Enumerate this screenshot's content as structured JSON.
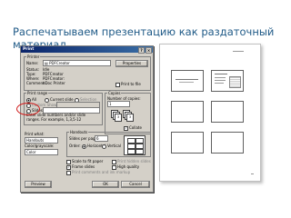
{
  "slide_title": "Распечатываем презентацию как раздаточный материал",
  "dialog": {
    "title": "Print",
    "printer": {
      "caption": "Printer",
      "name_label": "Name:",
      "name_value": "PDFCreator",
      "properties_button": "Properties",
      "status_label": "Status:",
      "status_value": "Idle",
      "type_label": "Type:",
      "type_value": "PDFCreator",
      "where_label": "Where:",
      "where_value": "PDFCreator:",
      "comment_label": "Comment:",
      "comment_value": "eDoc Printer",
      "print_to_file": "Print to file"
    },
    "print_range": {
      "caption": "Print range",
      "all": "All",
      "current_slide": "Current slide",
      "selection": "Selection",
      "custom_show": "Custom Show:",
      "slides": "Slides:",
      "hint": "Enter slide numbers and/or slide ranges. For example, 1,3,5-12"
    },
    "copies": {
      "caption": "Copies",
      "number_label": "Number of copies:",
      "number_value": "1",
      "collate": "Collate"
    },
    "print_what": {
      "label": "Print what:",
      "value": "Handouts"
    },
    "color": {
      "label": "Color/grayscale:",
      "value": "Color"
    },
    "handouts": {
      "caption": "Handouts",
      "slides_per_page_label": "Slides per page:",
      "slides_per_page_value": "6",
      "order_label": "Order:",
      "horizontal": "Horizontal",
      "vertical": "Vertical"
    },
    "options": {
      "scale": "Scale to fit paper",
      "frame": "Frame slides",
      "print_comments": "Print comments and ink markup",
      "hidden": "Print hidden slides",
      "high_quality": "High quality"
    },
    "buttons": {
      "preview": "Preview",
      "ok": "OK",
      "cancel": "Cancel"
    }
  }
}
